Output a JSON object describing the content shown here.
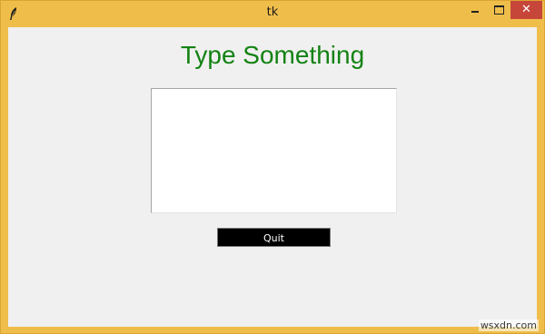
{
  "window": {
    "title": "tk",
    "icon": "feather-icon",
    "controls": {
      "minimize_icon": "minimize-icon",
      "maximize_icon": "maximize-icon",
      "close_label": "✕"
    }
  },
  "main": {
    "heading": "Type Something",
    "heading_color": "#138213",
    "text_input_value": "",
    "quit_label": "Quit"
  },
  "watermark": "wsxdn.com",
  "colors": {
    "window_frame": "#efbe4a",
    "close_button": "#c7463a",
    "client_bg": "#f0f0f0",
    "quit_button_bg": "#000000"
  }
}
